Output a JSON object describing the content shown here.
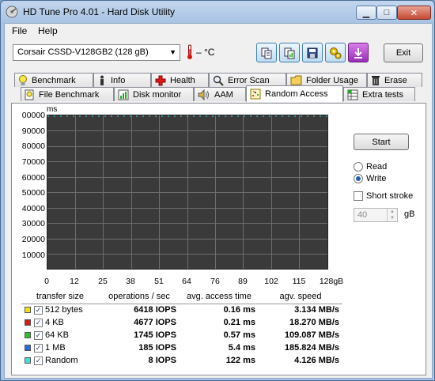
{
  "window": {
    "title": "HD Tune Pro 4.01 - Hard Disk Utility"
  },
  "menu": {
    "file": "File",
    "help": "Help"
  },
  "toolbar": {
    "drive": "Corsair CSSD-V128GB2 (128 gB)",
    "temperature": "– °C",
    "exit_label": "Exit",
    "icons": [
      "copy-info-icon",
      "copy-results-icon",
      "save-icon",
      "options-icon",
      "download-icon"
    ]
  },
  "tabs_row1": [
    {
      "label": "Benchmark",
      "icon": "lightbulb-icon"
    },
    {
      "label": "Info",
      "icon": "info-icon"
    },
    {
      "label": "Health",
      "icon": "health-cross-icon"
    },
    {
      "label": "Error Scan",
      "icon": "magnifier-icon"
    },
    {
      "label": "Folder Usage",
      "icon": "folder-icon"
    },
    {
      "label": "Erase",
      "icon": "trash-icon"
    }
  ],
  "tabs_row2": [
    {
      "label": "File Benchmark",
      "icon": "file-bulb-icon"
    },
    {
      "label": "Disk monitor",
      "icon": "bar-monitor-icon"
    },
    {
      "label": "AAM",
      "icon": "speaker-icon"
    },
    {
      "label": "Random Access",
      "icon": "random-access-icon",
      "active": true
    },
    {
      "label": "Extra tests",
      "icon": "grid-icon"
    }
  ],
  "random_access": {
    "y_unit": "ms",
    "y_ticks": [
      "00000",
      "90000",
      "80000",
      "70000",
      "60000",
      "50000",
      "40000",
      "30000",
      "20000",
      "10000"
    ],
    "x_ticks": [
      "0",
      "12",
      "25",
      "38",
      "51",
      "64",
      "76",
      "89",
      "102",
      "115",
      "128gB"
    ],
    "start_label": "Start",
    "read_label": "Read",
    "write_label": "Write",
    "mode": "write",
    "short_stroke_label": "Short stroke",
    "short_stroke_checked": false,
    "short_stroke_value": "40",
    "short_stroke_unit": "gB",
    "plot_background": "#3a3a3a",
    "gridline_color": "#6e6e6e",
    "columns": [
      "transfer size",
      "operations / sec",
      "avg. access time",
      "agv. speed"
    ],
    "rows": [
      {
        "size": "512 bytes",
        "color": "#f0e400",
        "checked": true,
        "ops": "6418 IOPS",
        "access": "0.16 ms",
        "speed": "3.134 MB/s"
      },
      {
        "size": "4 KB",
        "color": "#d41a1a",
        "checked": true,
        "ops": "4677 IOPS",
        "access": "0.21 ms",
        "speed": "18.270 MB/s"
      },
      {
        "size": "64 KB",
        "color": "#2cc02c",
        "checked": true,
        "ops": "1745 IOPS",
        "access": "0.57 ms",
        "speed": "109.087 MB/s"
      },
      {
        "size": "1 MB",
        "color": "#2a6be0",
        "checked": true,
        "ops": "185 IOPS",
        "access": "5.4 ms",
        "speed": "185.824 MB/s"
      },
      {
        "size": "Random",
        "color": "#40e0e0",
        "checked": true,
        "ops": "8 IOPS",
        "access": "122 ms",
        "speed": "4.126 MB/s"
      }
    ]
  }
}
